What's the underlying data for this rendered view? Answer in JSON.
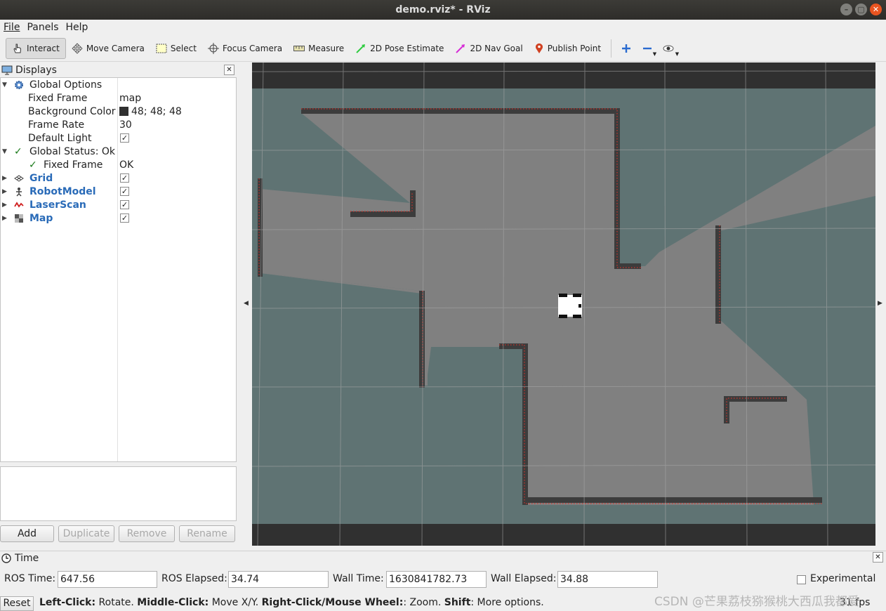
{
  "window": {
    "title": "demo.rviz* - RViz"
  },
  "menu": [
    "File",
    "Panels",
    "Help"
  ],
  "toolbar": {
    "interact": "Interact",
    "move_camera": "Move Camera",
    "select": "Select",
    "focus_camera": "Focus Camera",
    "measure": "Measure",
    "pose_estimate": "2D Pose Estimate",
    "nav_goal": "2D Nav Goal",
    "publish_point": "Publish Point"
  },
  "displays": {
    "title": "Displays",
    "global_options": {
      "label": "Global Options",
      "fixed_frame_label": "Fixed Frame",
      "fixed_frame_value": "map",
      "bg_color_label": "Background Color",
      "bg_color_value": "48; 48; 48",
      "bg_color_hex": "#303030",
      "frame_rate_label": "Frame Rate",
      "frame_rate_value": "30",
      "default_light_label": "Default Light",
      "default_light_value": true
    },
    "global_status": {
      "label": "Global Status: Ok",
      "fixed_frame_label": "Fixed Frame",
      "fixed_frame_value": "OK"
    },
    "plugins": [
      {
        "name": "Grid",
        "icon": "grid-icon",
        "enabled": true
      },
      {
        "name": "RobotModel",
        "icon": "robot-model-icon",
        "enabled": true
      },
      {
        "name": "LaserScan",
        "icon": "laser-scan-icon",
        "enabled": true
      },
      {
        "name": "Map",
        "icon": "map-icon",
        "enabled": true
      }
    ],
    "buttons": {
      "add": "Add",
      "duplicate": "Duplicate",
      "remove": "Remove",
      "rename": "Rename"
    }
  },
  "time": {
    "title": "Time",
    "ros_time_label": "ROS Time:",
    "ros_time": "647.56",
    "ros_elapsed_label": "ROS Elapsed:",
    "ros_elapsed": "34.74",
    "wall_time_label": "Wall Time:",
    "wall_time": "1630841782.73",
    "wall_elapsed_label": "Wall Elapsed:",
    "wall_elapsed": "34.88",
    "experimental_label": "Experimental",
    "experimental": false
  },
  "status": {
    "reset": "Reset",
    "k1": "Left-Click:",
    "t1": " Rotate. ",
    "k2": "Middle-Click:",
    "t2": " Move X/Y. ",
    "k3": "Right-Click/Mouse Wheel:",
    "t3": ": Zoom. ",
    "k4": "Shift",
    "t4": ": More options.",
    "fps": "31 fps",
    "watermark": "CSDN @芒果荔枝猕猴桃大西瓜我都爱"
  },
  "colors": {
    "map_free": "#808080",
    "map_unknown": "#5f7373",
    "map_wall": "#3c3c3c",
    "laser": "#d0342c",
    "background": "#303030"
  }
}
